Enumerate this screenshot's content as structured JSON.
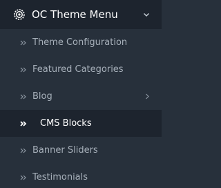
{
  "menu": {
    "title": "OC Theme Menu",
    "header_icon": "gear-icon",
    "expand_icon": "chevron-down-icon",
    "items": [
      {
        "label": "Theme Configuration",
        "icon": "double-chevron-right-icon",
        "active": false,
        "has_submenu": false
      },
      {
        "label": "Featured Categories",
        "icon": "double-chevron-right-icon",
        "active": false,
        "has_submenu": false
      },
      {
        "label": "Blog",
        "icon": "double-chevron-right-icon",
        "active": false,
        "has_submenu": true
      },
      {
        "label": "CMS Blocks",
        "icon": "double-chevron-right-icon",
        "active": true,
        "has_submenu": false
      },
      {
        "label": "Banner Sliders",
        "icon": "double-chevron-right-icon",
        "active": false,
        "has_submenu": false
      },
      {
        "label": "Testimonials",
        "icon": "double-chevron-right-icon",
        "active": false,
        "has_submenu": false
      }
    ]
  },
  "colors": {
    "panel_background": "#27303b",
    "header_background": "#1d242e",
    "active_background": "#1d242e",
    "text_default": "#a7b0ba",
    "text_active": "#ffffff"
  }
}
